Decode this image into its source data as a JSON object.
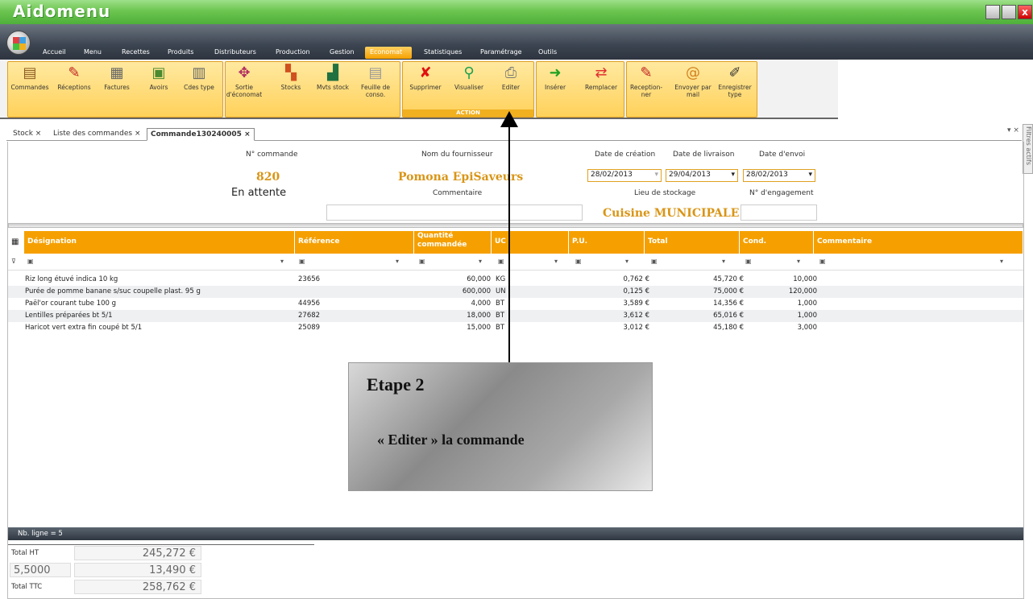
{
  "app": {
    "title": "Aidomenu"
  },
  "menu": {
    "tabs": [
      "Accueil",
      "Menu",
      "Recettes",
      "Produits",
      "Distributeurs",
      "Production",
      "Gestion",
      "Economat",
      "Statistiques",
      "Paramétrage",
      "Outils"
    ],
    "active": "Economat"
  },
  "ribbon": {
    "buttons": [
      {
        "label": "Commandes",
        "icon": "book-icon"
      },
      {
        "label": "Réceptions",
        "icon": "pen-document-icon"
      },
      {
        "label": "Factures",
        "icon": "invoice-icon"
      },
      {
        "label": "Avoirs",
        "icon": "credit-note-icon"
      },
      {
        "label": "Cdes type",
        "icon": "document-template-icon"
      },
      {
        "label": "Sortie d'économat",
        "icon": "exit-goods-icon"
      },
      {
        "label": "Stocks",
        "icon": "boxes-icon"
      },
      {
        "label": "Mvts stock",
        "icon": "stock-movement-chart-icon"
      },
      {
        "label": "Feuille de conso.",
        "icon": "consumption-sheet-icon"
      },
      {
        "label": "Supprimer",
        "icon": "delete-x-icon"
      },
      {
        "label": "Visualiser",
        "icon": "magnifier-icon"
      },
      {
        "label": "Editer",
        "icon": "printer-icon"
      },
      {
        "label": "Insérer",
        "icon": "insert-arrow-icon"
      },
      {
        "label": "Remplacer",
        "icon": "replace-arrows-icon"
      },
      {
        "label": "Reception-ner",
        "icon": "receive-pen-icon"
      },
      {
        "label": "Envoyer par mail",
        "icon": "mail-icon"
      },
      {
        "label": "Enregistrer type",
        "icon": "save-template-icon"
      }
    ],
    "group_action_title": "ACTION"
  },
  "doc_tabs": [
    {
      "label": "Stock",
      "close": "×"
    },
    {
      "label": "Liste des commandes",
      "close": "×"
    },
    {
      "label": "Commande130240005",
      "close": "×"
    }
  ],
  "side_panel_label": "Filtres actifs",
  "order": {
    "num_label": "N° commande",
    "num_value": "820",
    "status": "En attente",
    "supplier_label": "Nom du fournisseur",
    "supplier_value": "Pomona EpiSaveurs",
    "comment_label": "Commentaire",
    "date_creation_label": "Date de création",
    "date_creation": "28/02/2013",
    "date_livraison_label": "Date de livraison",
    "date_livraison": "29/04/2013",
    "date_envoi_label": "Date d'envoi",
    "date_envoi": "28/02/2013",
    "stockage_label": "Lieu de stockage",
    "stockage_value": "Cuisine MUNICIPALE",
    "engagement_label": "N° d'engagement"
  },
  "grid": {
    "columns": [
      "Désignation",
      "Référence",
      "Quantité commandée",
      "UC",
      "P.U.",
      "Total",
      "Cond.",
      "Commentaire"
    ],
    "rows": [
      {
        "designation": "Riz long étuvé indica 10 kg",
        "reference": "23656",
        "quantite": "60,000",
        "uc": "KG",
        "pu": "0,762 €",
        "total": "45,720 €",
        "cond": "10,000"
      },
      {
        "designation": "Purée de pomme banane s/suc coupelle plast. 95 g",
        "reference": "",
        "quantite": "600,000",
        "uc": "UN",
        "pu": "0,125 €",
        "total": "75,000 €",
        "cond": "120,000"
      },
      {
        "designation": "Paël'or courant tube 100 g",
        "reference": "44956",
        "quantite": "4,000",
        "uc": "BT",
        "pu": "3,589 €",
        "total": "14,356 €",
        "cond": "1,000"
      },
      {
        "designation": "Lentilles préparées bt 5/1",
        "reference": "27682",
        "quantite": "18,000",
        "uc": "BT",
        "pu": "3,612 €",
        "total": "65,016 €",
        "cond": "1,000"
      },
      {
        "designation": "Haricot vert extra fin coupé bt 5/1",
        "reference": "25089",
        "quantite": "15,000",
        "uc": "BT",
        "pu": "3,012 €",
        "total": "45,180 €",
        "cond": "3,000"
      }
    ]
  },
  "footer": {
    "status": "Nb. ligne = 5",
    "total_ht_label": "Total HT",
    "total_ht": "245,272 €",
    "tva_rate": "5,5000",
    "tva_amount": "13,490 €",
    "total_ttc_label": "Total TTC",
    "total_ttc": "258,762 €"
  },
  "annotation": {
    "title": "Etape 2",
    "body": "« Editer » la commande"
  },
  "colors": {
    "accent": "#f5a000",
    "title_green": "#6cc550",
    "menubar": "#3b4450"
  }
}
